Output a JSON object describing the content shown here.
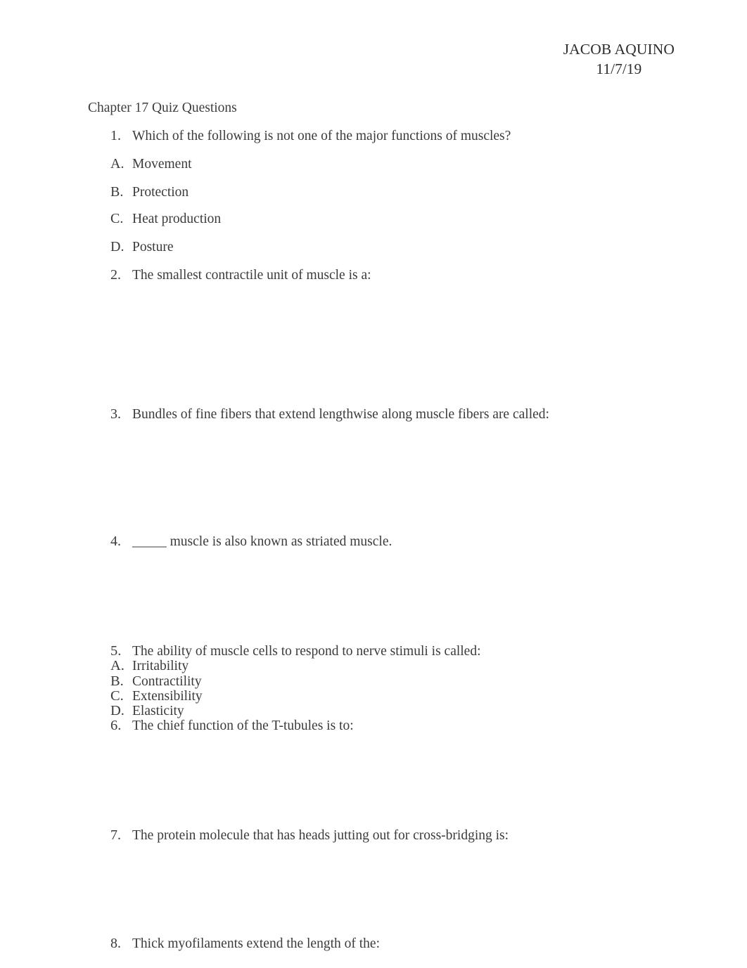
{
  "header": {
    "name": "JACOB AQUINO",
    "date": "11/7/19"
  },
  "document": {
    "title": "Chapter 17 Quiz Questions"
  },
  "items": [
    {
      "marker": "1.",
      "text": "Which of the following is not one of the major functions of muscles?"
    },
    {
      "marker": "A.",
      "text": "Movement"
    },
    {
      "marker": "B.",
      "text": "Protection"
    },
    {
      "marker": "C.",
      "text": "Heat production"
    },
    {
      "marker": "D.",
      "text": "Posture"
    },
    {
      "marker": "2.",
      "text": "The smallest contractile unit of muscle is a:"
    },
    {
      "marker": "3.",
      "text": "Bundles of fine fibers that extend lengthwise along muscle fibers are called:"
    },
    {
      "marker": "4.",
      "text": "_____ muscle is also known as striated muscle."
    },
    {
      "marker": "5.",
      "text": "The ability of muscle cells to respond to nerve stimuli is called:"
    },
    {
      "marker": "A.",
      "text": "Irritability"
    },
    {
      "marker": "B.",
      "text": "Contractility"
    },
    {
      "marker": "C.",
      "text": "Extensibility"
    },
    {
      "marker": "D.",
      "text": "Elasticity"
    },
    {
      "marker": "6.",
      "text": "The chief function of the T-tubules is to:"
    },
    {
      "marker": "7.",
      "text": "The protein molecule that has heads jutting out for cross-bridging is:"
    },
    {
      "marker": "8.",
      "text": "Thick myofilaments extend the length of the:"
    }
  ]
}
